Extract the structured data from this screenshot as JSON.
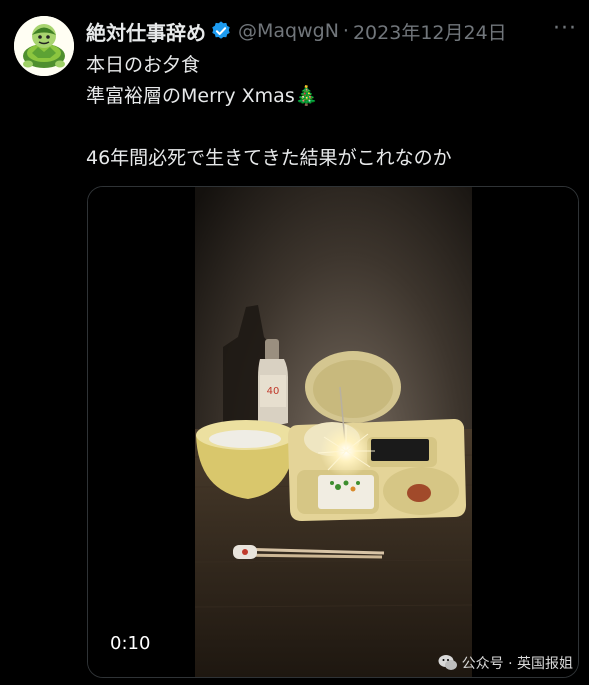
{
  "author": {
    "name": "絶対仕事辞め",
    "handle": "@MaqwgN",
    "separator": "·",
    "date": "2023年12月24日"
  },
  "more_label": "···",
  "tweet": {
    "lines": [
      "本日のお夕食",
      "準富裕層のMerry Xmas🎄",
      "",
      "46年間必死で生きてきた結果がこれなのか"
    ]
  },
  "media": {
    "duration": "0:10"
  },
  "watermark": {
    "text": "公众号 · 英国报姐"
  },
  "colors": {
    "background": "#000000",
    "text": "#e7e9ea",
    "muted": "#71767b",
    "verified": "#1d9bf0"
  }
}
